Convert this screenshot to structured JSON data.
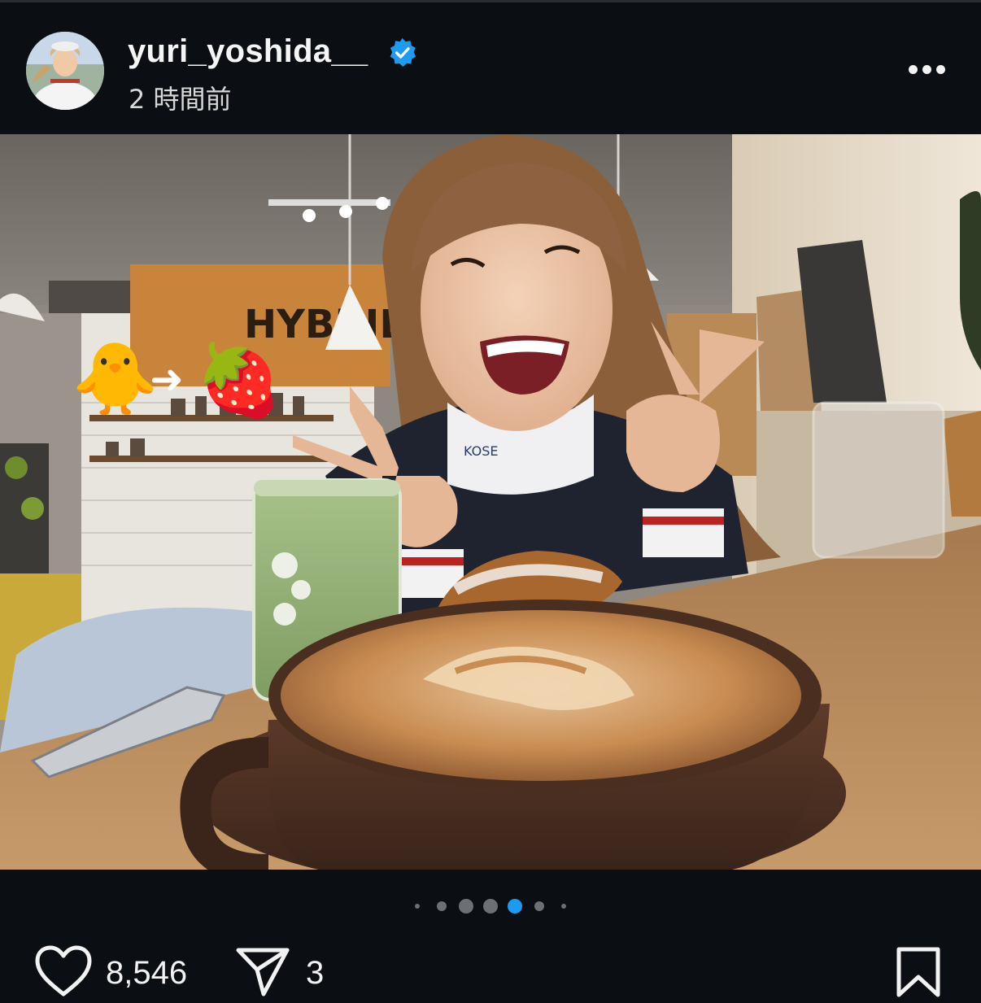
{
  "post": {
    "username": "yuri_yoshida__",
    "verified": true,
    "timestamp": "2 時間前",
    "more_icon": "more-horizontal-icon"
  },
  "media": {
    "sticker_left": "🐥",
    "sticker_arrow": "➜",
    "sticker_right": "🍓",
    "sign_text": "HYBRID",
    "cup_text": "KOSE",
    "carousel_total": 7,
    "carousel_active_index": 4
  },
  "actions": {
    "likes": "8,546",
    "shares": "3"
  },
  "colors": {
    "background": "#0b0e12",
    "verified_blue": "#1d9bf0",
    "active_dot": "#1d9bf0",
    "inactive_dot": "#6c6f74"
  }
}
